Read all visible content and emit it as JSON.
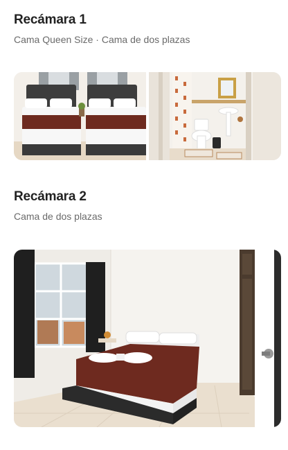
{
  "rooms": [
    {
      "title": "Recámara 1",
      "subtitle": "Cama Queen Size · Cama de dos plazas"
    },
    {
      "title": "Recámara 2",
      "subtitle": "Cama de dos plazas"
    }
  ],
  "colors": {
    "title": "#222222",
    "subtitle": "#6a6a6a",
    "blanket": "#6e2a1f",
    "headboard": "#3a3a3a",
    "curtain": "#1f1f1f"
  }
}
